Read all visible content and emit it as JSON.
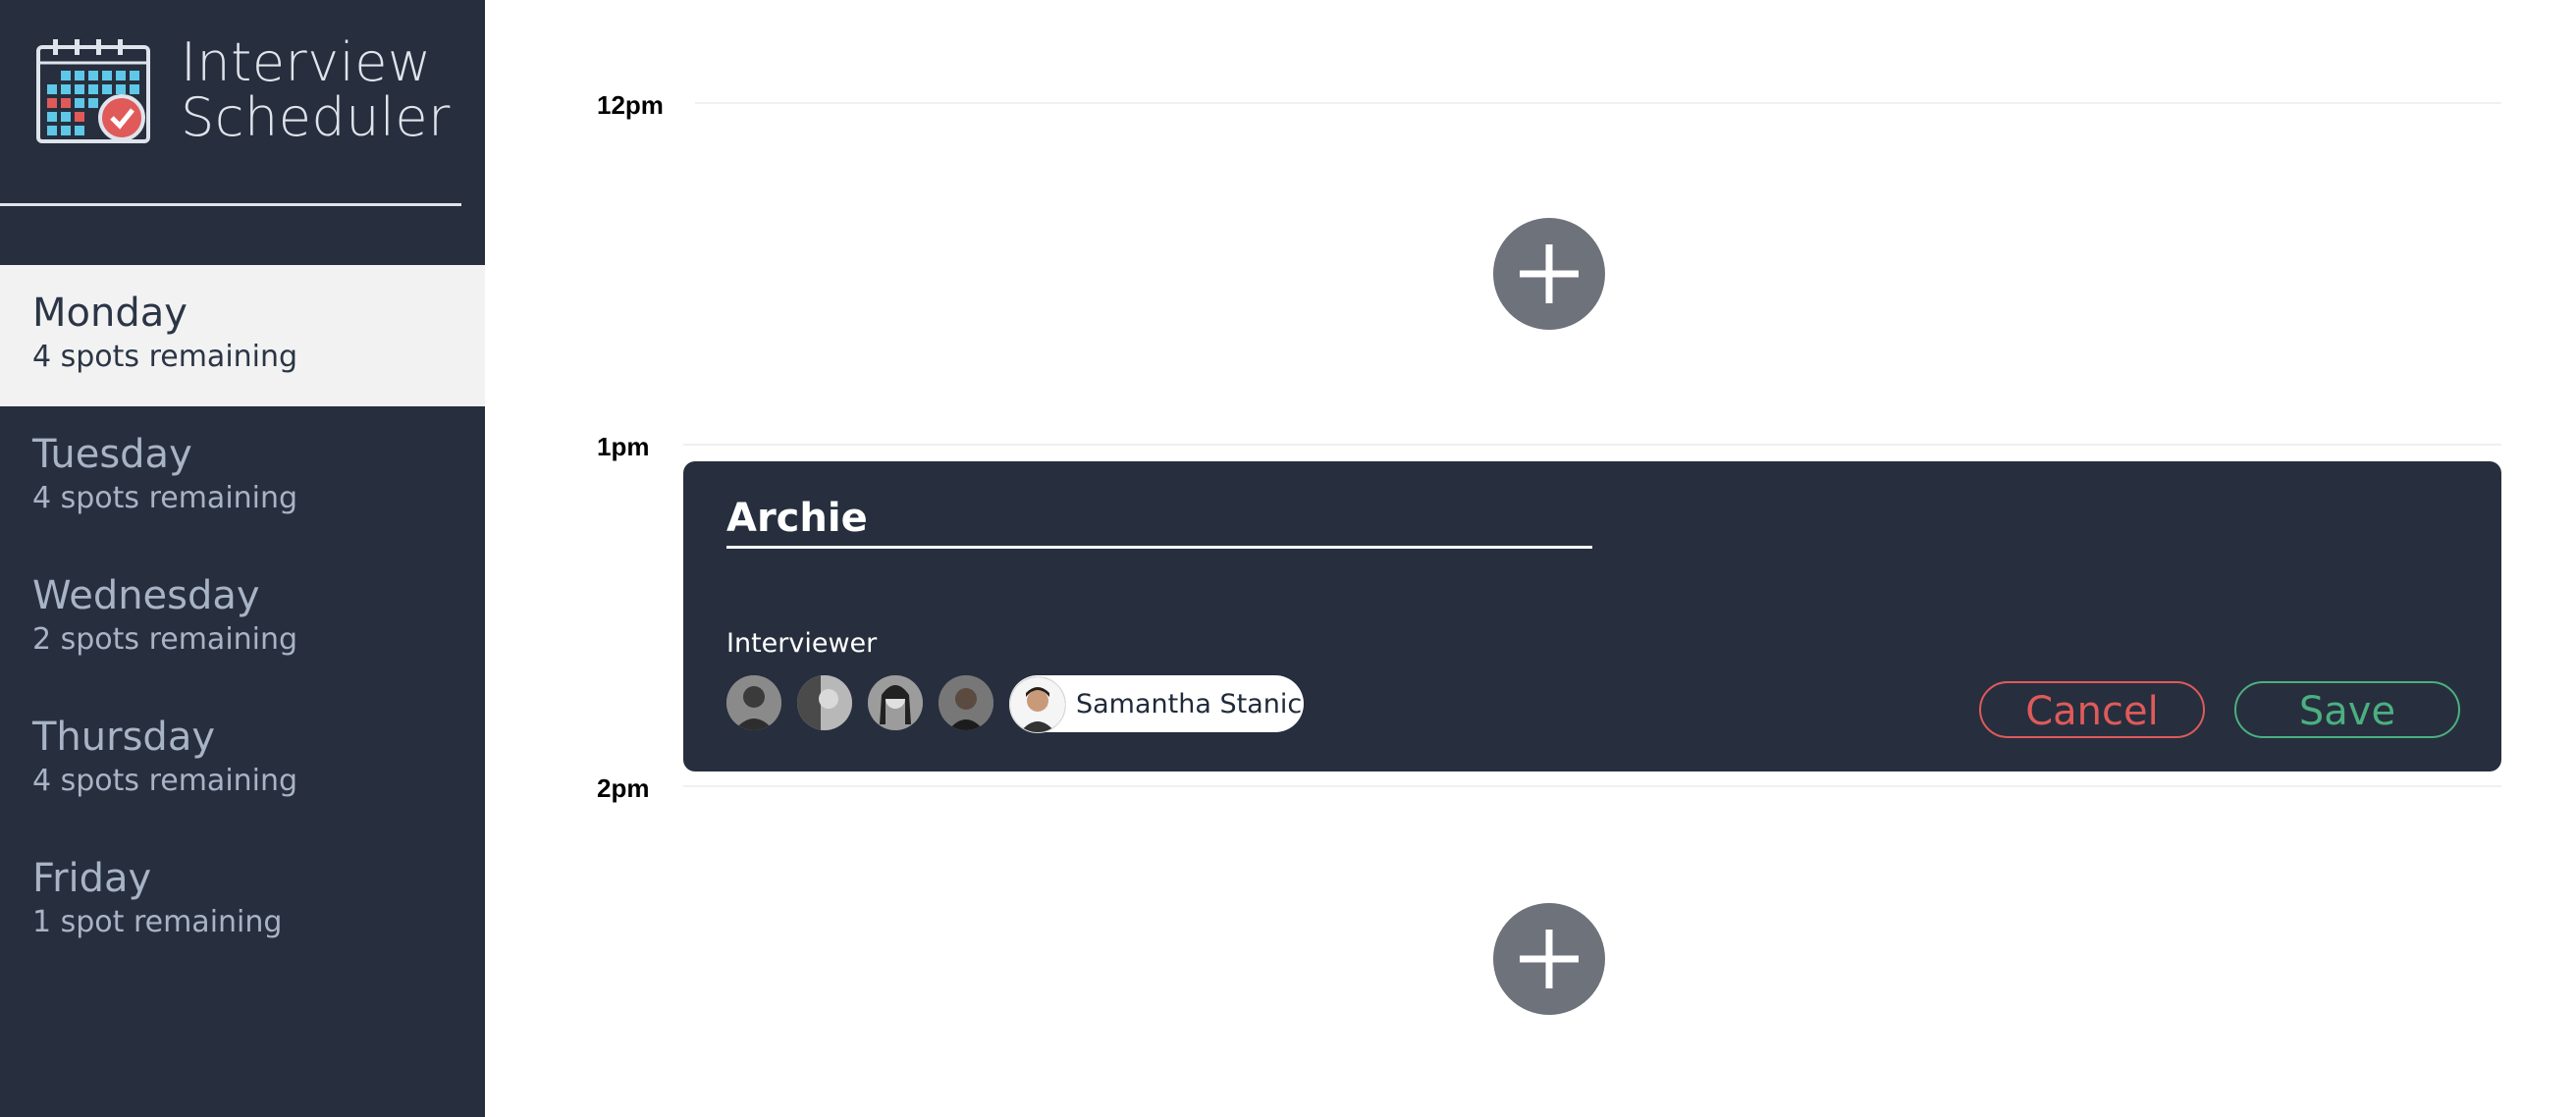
{
  "app": {
    "title_line1": "Interview",
    "title_line2": "Scheduler"
  },
  "days": [
    {
      "name": "Monday",
      "spots": "4 spots remaining",
      "selected": true
    },
    {
      "name": "Tuesday",
      "spots": "4 spots remaining",
      "selected": false
    },
    {
      "name": "Wednesday",
      "spots": "2 spots remaining",
      "selected": false
    },
    {
      "name": "Thursday",
      "spots": "4 spots remaining",
      "selected": false
    },
    {
      "name": "Friday",
      "spots": "1 spot remaining",
      "selected": false
    }
  ],
  "schedule": {
    "times": [
      "12pm",
      "1pm",
      "2pm"
    ]
  },
  "form": {
    "student_name": "Archie",
    "interviewer_label": "Interviewer",
    "selected_interviewer": "Samantha Stanic",
    "cancel_label": "Cancel",
    "save_label": "Save"
  },
  "colors": {
    "sidebar_bg": "#272f3e",
    "cancel": "#e05a5a",
    "save": "#4caf80",
    "add_button": "#6d727b"
  },
  "icons": {
    "logo": "calendar-check-icon",
    "add": "plus-icon"
  }
}
